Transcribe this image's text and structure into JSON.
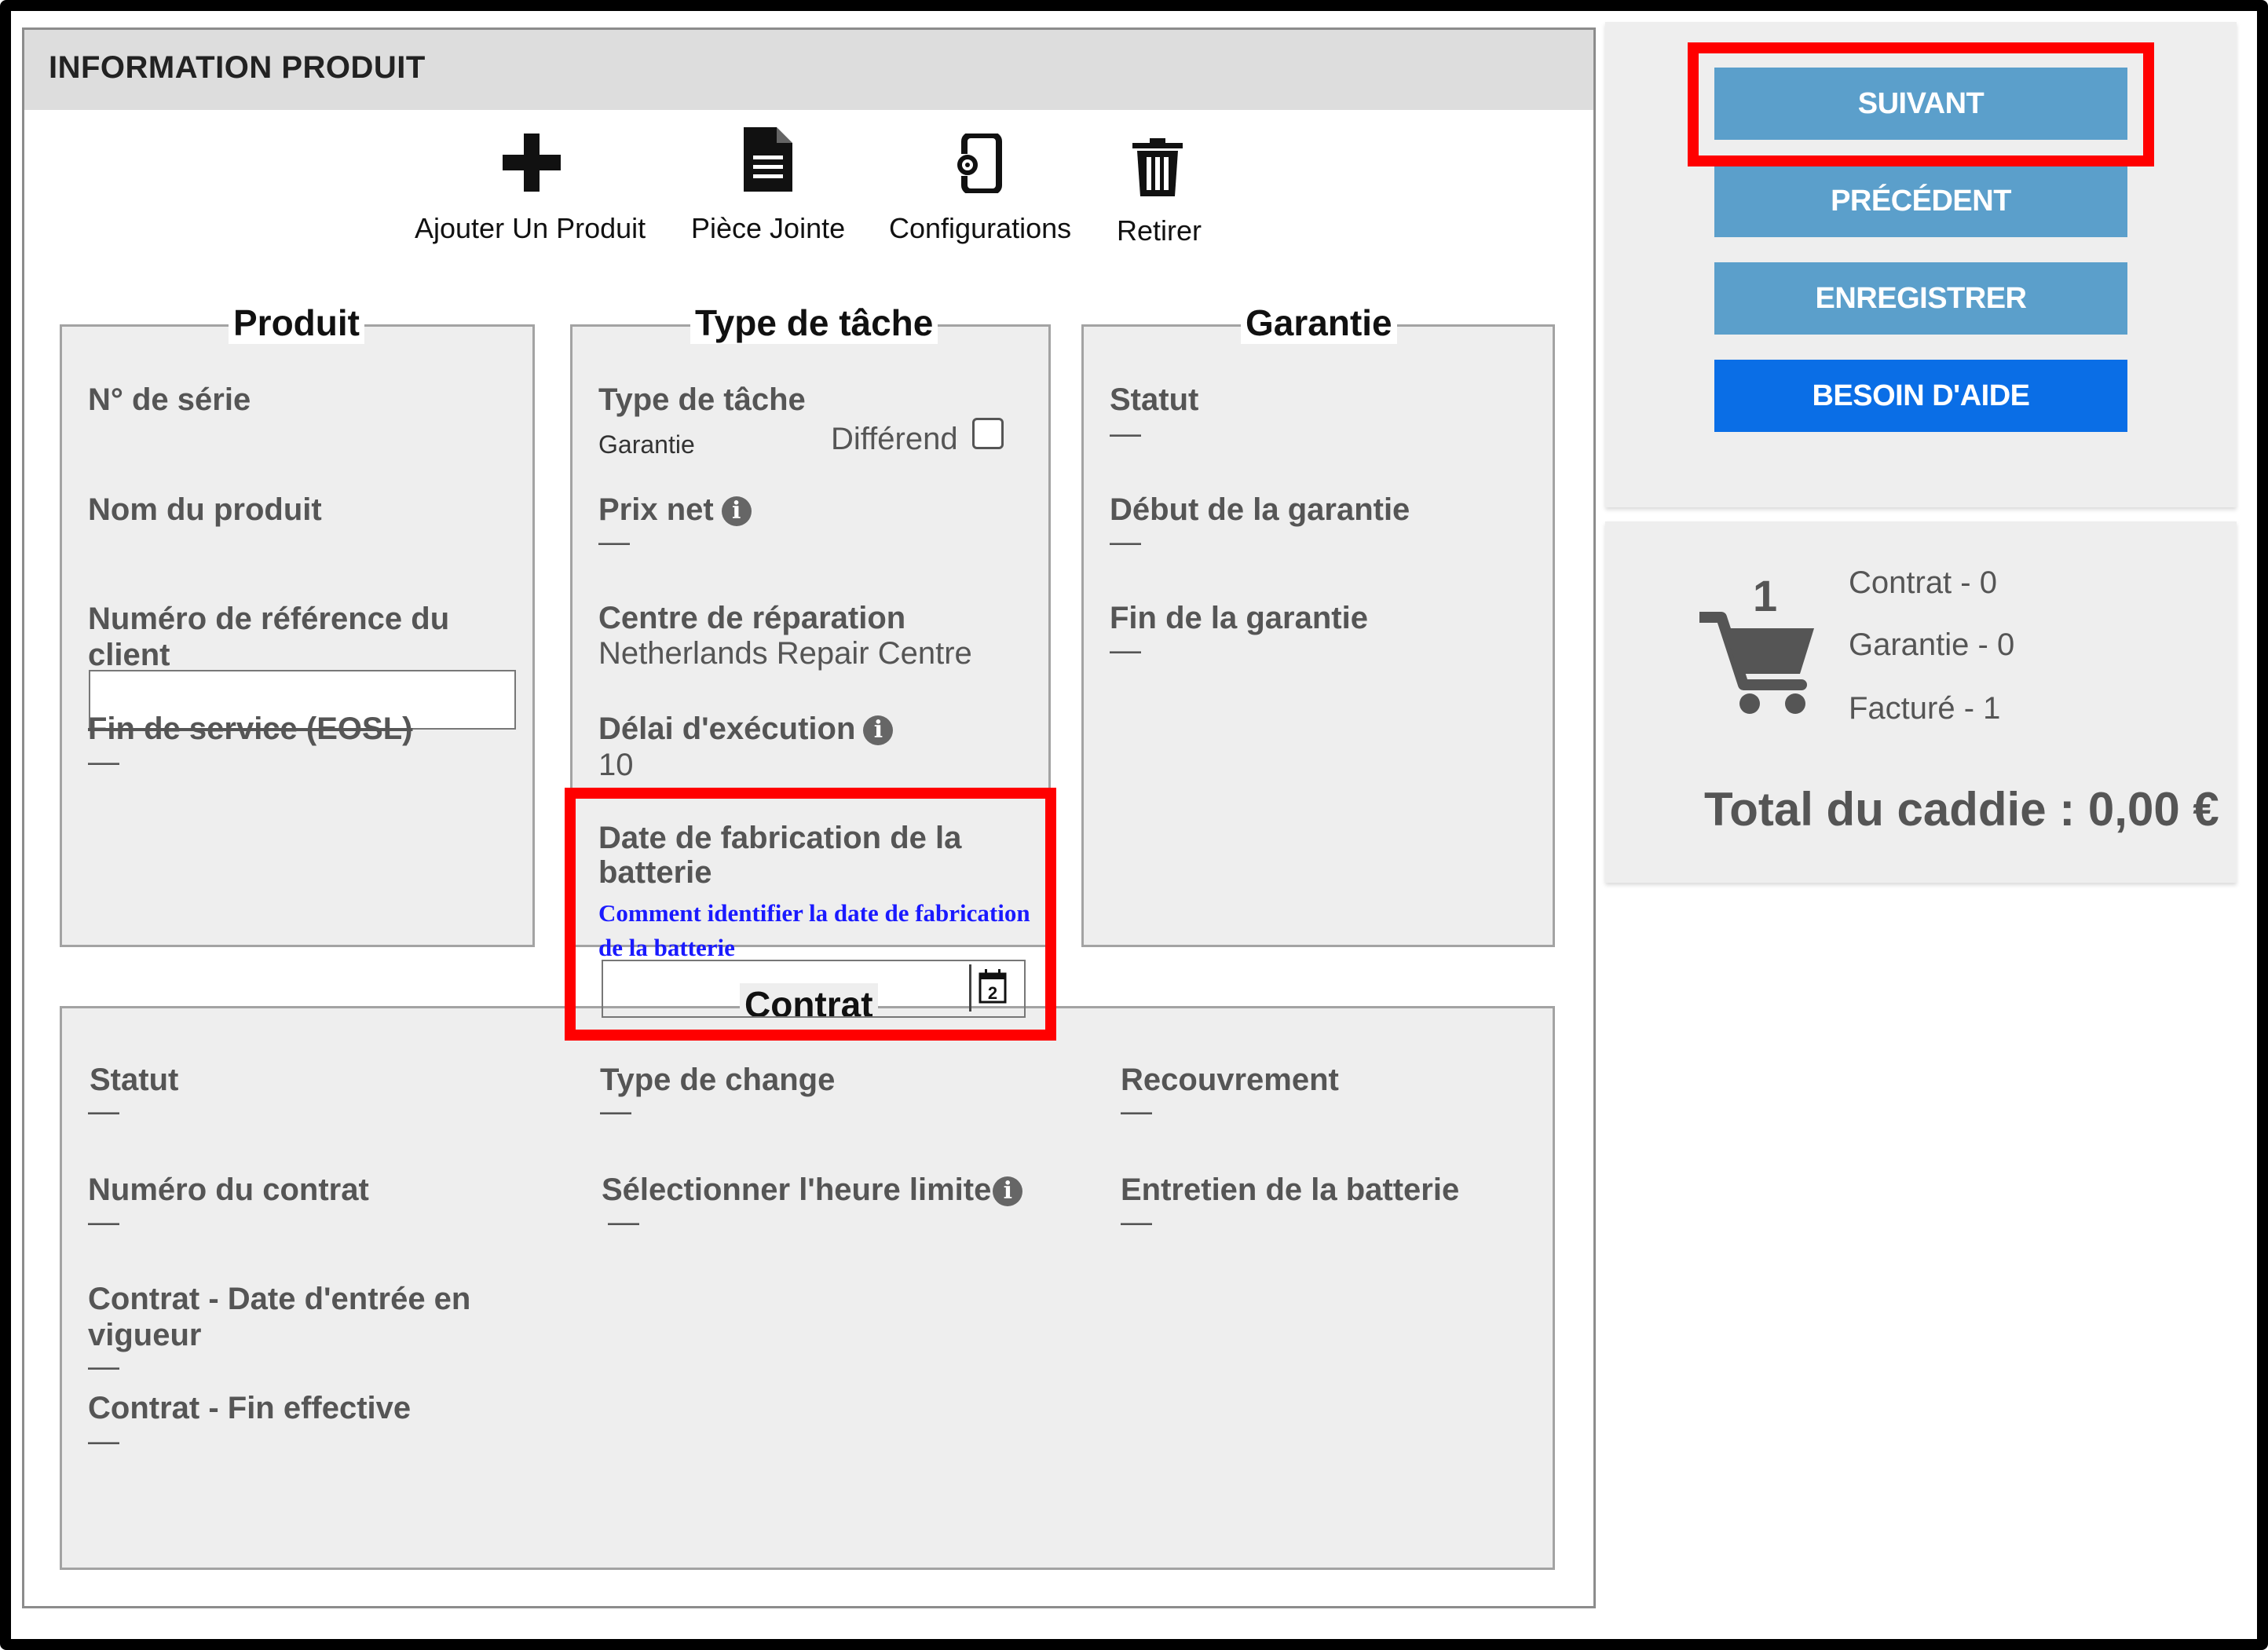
{
  "panel": {
    "title": "INFORMATION PRODUIT"
  },
  "toolbar": {
    "add_product": "Ajouter Un Produit",
    "attachment": "Pièce Jointe",
    "configurations": "Configurations",
    "remove": "Retirer",
    "icons": [
      "plus-icon",
      "document-icon",
      "device-config-icon",
      "trash-icon"
    ]
  },
  "produit": {
    "legend": "Produit",
    "serial_label": "N° de série",
    "name_label": "Nom du produit",
    "client_ref_label": "Numéro de référence du client",
    "client_ref_value": "",
    "eosl_label": "Fin de service (EOSL)",
    "eosl_value": "—"
  },
  "tache": {
    "legend": "Type de tâche",
    "type_label": "Type de tâche",
    "type_value": "Garantie",
    "dispute_label": "Différend",
    "dispute_checked": false,
    "prix_label": "Prix net",
    "prix_value": "—",
    "centre_label": "Centre de réparation",
    "centre_value": "Netherlands Repair Centre",
    "delai_label": "Délai d'exécution",
    "delai_value": "10",
    "battery_label": "Date de fabrication de la batterie",
    "battery_link": "Comment identifier la date de fabrication de la batterie",
    "battery_date_value": "",
    "info_symbol": "i"
  },
  "garantie": {
    "legend": "Garantie",
    "statut_label": "Statut",
    "statut_value": "—",
    "debut_label": "Début de la garantie",
    "debut_value": "—",
    "fin_label": "Fin de la garantie",
    "fin_value": "—"
  },
  "contrat": {
    "legend": "Contrat",
    "statut_label": "Statut",
    "statut_value": "—",
    "numero_label": "Numéro du contrat",
    "numero_value": "—",
    "entree_label": "Contrat - Date d'entrée en vigueur",
    "entree_value": "—",
    "fin_label": "Contrat - Fin effective",
    "fin_value": "—",
    "change_label": "Type de change",
    "change_value": "—",
    "heure_label": "Sélectionner l'heure limite",
    "heure_value": "—",
    "recouvrement_label": "Recouvrement",
    "recouvrement_value": "—",
    "entretien_label": "Entretien de la batterie",
    "entretien_value": "—"
  },
  "actions": {
    "next": "SUIVANT",
    "previous": "PRÉCÉDENT",
    "save": "ENREGISTRER",
    "help": "BESOIN D'AIDE",
    "colors": {
      "primary": "#5b9fcb",
      "help": "#0a6ee6",
      "highlight": "#ff0000"
    }
  },
  "cart": {
    "count": "1",
    "contrat": "Contrat - 0",
    "garantie": "Garantie - 0",
    "facture": "Facturé - 1",
    "total": "Total du caddie : 0,00 €",
    "icon": "shopping-cart-icon"
  }
}
